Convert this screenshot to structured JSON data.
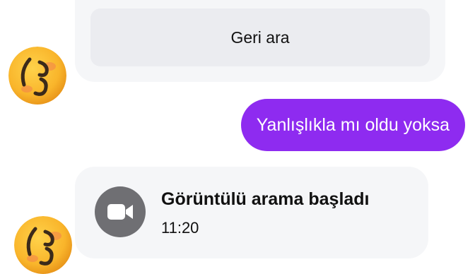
{
  "callback_card": {
    "button_label": "Geri ara"
  },
  "outgoing_message": {
    "text": "Yanlışlıkla mı oldu yoksa",
    "bubble_color": "#8e2bf0"
  },
  "video_call_card": {
    "icon": "video-camera-icon",
    "title": "Görüntülü arama başladı",
    "time": "11:20"
  },
  "avatars": [
    {
      "icon": "tilted-face-emoji-icon"
    },
    {
      "icon": "tilted-face-emoji-icon"
    }
  ]
}
